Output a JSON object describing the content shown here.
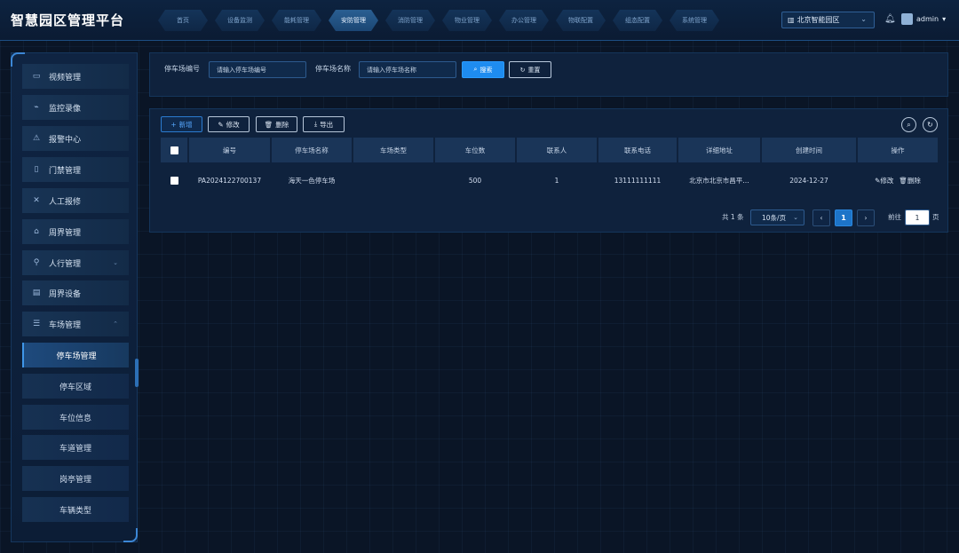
{
  "header": {
    "title": "智慧园区管理平台",
    "nav": [
      "首页",
      "设备监测",
      "能耗管理",
      "安防管理",
      "消防管理",
      "物业管理",
      "办公管理",
      "物联配置",
      "组态配置",
      "系统管理"
    ],
    "active_nav": "安防管理",
    "park_select": "北京智能园区",
    "user": "admin"
  },
  "sidebar": {
    "items": [
      {
        "label": "视频管理",
        "icon": "video-icon"
      },
      {
        "label": "监控录像",
        "icon": "camera-icon"
      },
      {
        "label": "报警中心",
        "icon": "alarm-icon"
      },
      {
        "label": "门禁管理",
        "icon": "door-icon"
      },
      {
        "label": "人工报修",
        "icon": "tools-icon"
      },
      {
        "label": "周界管理",
        "icon": "perimeter-icon"
      },
      {
        "label": "人行管理",
        "icon": "pedestrian-icon",
        "expandable": true
      },
      {
        "label": "周界设备",
        "icon": "device-icon"
      },
      {
        "label": "车场管理",
        "icon": "parking-icon",
        "expandable": true,
        "expanded": true
      }
    ],
    "sub_items": [
      "停车场管理",
      "停车区域",
      "车位信息",
      "车道管理",
      "岗亭管理",
      "车辆类型"
    ],
    "active_sub": "停车场管理"
  },
  "search": {
    "code_label": "停车场编号",
    "code_placeholder": "请输入停车场编号",
    "name_label": "停车场名称",
    "name_placeholder": "请输入停车场名称",
    "search_label": "搜索",
    "reset_label": "重置"
  },
  "toolbar": {
    "add_label": "新增",
    "edit_label": "修改",
    "delete_label": "删除",
    "export_label": "导出"
  },
  "table": {
    "columns": [
      "编号",
      "停车场名称",
      "车场类型",
      "车位数",
      "联系人",
      "联系电话",
      "详细地址",
      "创建时间",
      "操作"
    ],
    "rows": [
      {
        "code": "PA2024122700137",
        "name": "海天一色停车场",
        "type": "",
        "spaces": "500",
        "contact": "1",
        "phone": "13111111111",
        "address": "北京市北京市昌平…",
        "created": "2024-12-27",
        "edit": "修改",
        "delete": "删除"
      }
    ]
  },
  "pagination": {
    "total": "共 1 条",
    "page_size": "10条/页",
    "current": "1",
    "goto_label": "前往",
    "goto_value": "1",
    "page_unit": "页"
  },
  "colors": {
    "accent": "#1e8cf0",
    "background": "#0a1526",
    "panel": "#0f223d"
  }
}
